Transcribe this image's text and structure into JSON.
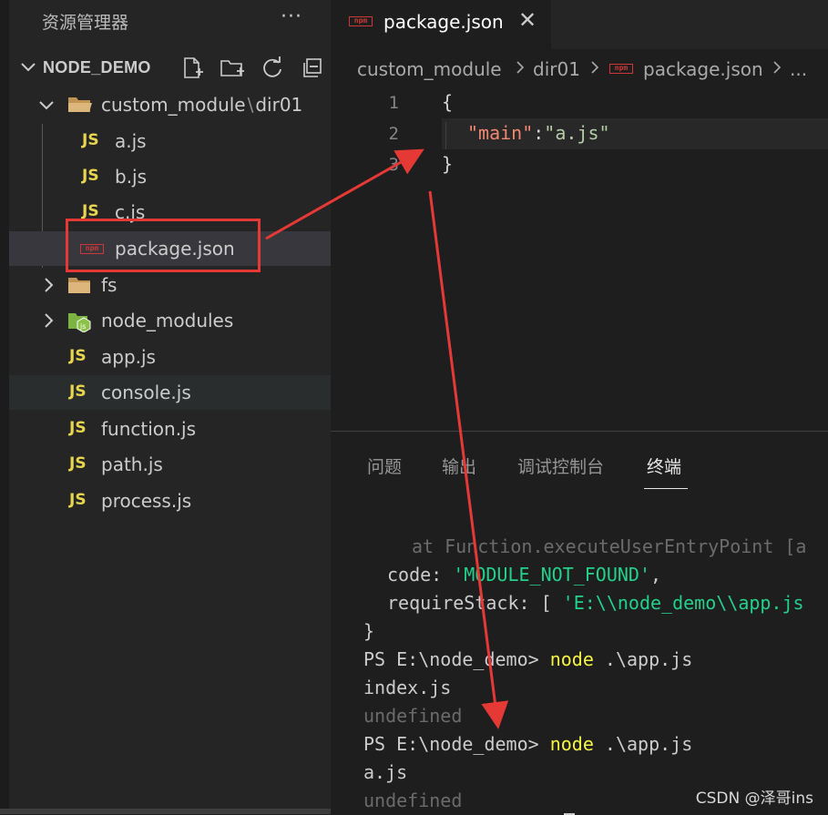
{
  "sidebar": {
    "title": "资源管理器",
    "more": "···",
    "project": "NODE_DEMO",
    "tree": {
      "folder": "custom_module",
      "folder_sep": "\\",
      "subfolder": "dir01",
      "files_nested": [
        "a.js",
        "b.js",
        "c.js",
        "package.json"
      ],
      "fs": "fs",
      "node_modules": "node_modules",
      "files_root": [
        "app.js",
        "console.js",
        "function.js",
        "path.js",
        "process.js"
      ]
    },
    "js_badge": "JS",
    "npm_badge": "npm"
  },
  "editor": {
    "tab": {
      "label": "package.json",
      "close": "✕"
    },
    "breadcrumb": [
      "custom_module",
      "dir01",
      "package.json",
      "..."
    ],
    "line_numbers": [
      "1",
      "2",
      "3"
    ],
    "code": {
      "line1": "{",
      "key": "\"main\"",
      "colon": ":",
      "value": "\"a.js\"",
      "line3": "}"
    }
  },
  "panel": {
    "tabs": [
      "问题",
      "输出",
      "调试控制台",
      "终端"
    ],
    "active_tab": "终端",
    "terminal": {
      "l1": "at Function.executeUserEntryPoint [a",
      "l2_key": "code: ",
      "l2_val": "'MODULE_NOT_FOUND'",
      "l2_end": ",",
      "l3_key": "requireStack: [ ",
      "l3_val": "'E:\\\\node_demo\\\\app.js",
      "l4": "}",
      "prompt1": "PS E:\\node_demo> ",
      "cmd": "node",
      "arg": " .\\app.js",
      "out1": "index.js",
      "undef": "undefined",
      "prompt2": "PS E:\\node_demo> ",
      "out2": "a.js"
    }
  },
  "watermark": "CSDN @泽哥ins",
  "colors": {
    "annotation": "#e53935",
    "js": "#e8d44d",
    "npm": "#cb3837",
    "string_green": "#23d18b",
    "command_yellow": "#f5f543"
  }
}
